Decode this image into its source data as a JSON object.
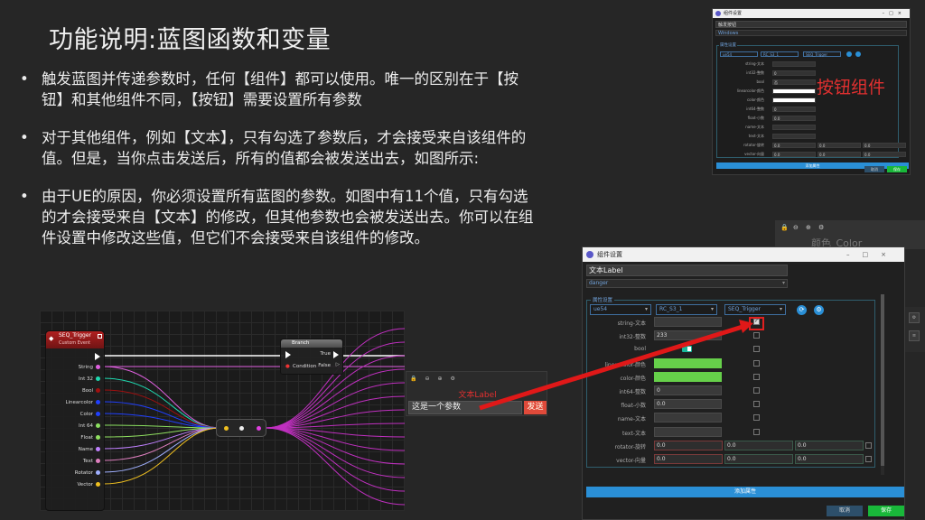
{
  "slide": {
    "title": "功能说明:蓝图函数和变量",
    "bullets": [
      "触发蓝图并传递参数时，任何【组件】都可以使用。唯一的区别在于【按钮】和其他组件不同，【按钮】需要设置所有参数",
      "对于其他组件，例如【文本】，只有勾选了参数后，才会接受来自该组件的值。但是，当你点击发送后，所有的值都会被发送出去，如图所示:",
      "由于UE的原因，你必须设置所有蓝图的参数。如图中有11个值，只有勾选的才会接受来自【文本】的修改，但其他参数也会被发送出去。你可以在组件设置中修改这些值，但它们不会接受来自该组件的修改。"
    ],
    "button_component_label": "按钮组件"
  },
  "mini_dialog": {
    "title": "组件设置",
    "name_value": "触发按钮",
    "style_value": "Windows",
    "group_label": "属性设置",
    "selects": [
      "ue54",
      "RC_S3_1",
      "SEQ_Trigger"
    ],
    "rows": [
      {
        "key": "string-文本",
        "value": ""
      },
      {
        "key": "int32-整数",
        "value": "0"
      },
      {
        "key": "bool",
        "value": "否"
      },
      {
        "key": "linearcolor-颜色",
        "value": ""
      },
      {
        "key": "color-颜色",
        "value": ""
      },
      {
        "key": "int64-整数",
        "value": "0"
      },
      {
        "key": "float-小数",
        "value": "0.0"
      },
      {
        "key": "name-文本",
        "value": ""
      },
      {
        "key": "text-文本",
        "value": ""
      },
      {
        "key": "rotator-旋转",
        "value": "0.0"
      },
      {
        "key": "vector-向量",
        "value": "0.0"
      }
    ],
    "add_label": "添加属性",
    "cancel_label": "取消",
    "save_label": "保存"
  },
  "blueprint": {
    "event_title": "SEQ_Trigger",
    "event_sub": "Custom Event",
    "pins": [
      {
        "label": "String",
        "color": "#e060e0"
      },
      {
        "label": "Int 32",
        "color": "#1ed9b0"
      },
      {
        "label": "Bool",
        "color": "#a01010"
      },
      {
        "label": "Linearcolor",
        "color": "#2040ff"
      },
      {
        "label": "Color",
        "color": "#2040ff"
      },
      {
        "label": "Int 64",
        "color": "#8be060"
      },
      {
        "label": "Float",
        "color": "#90e060"
      },
      {
        "label": "Name",
        "color": "#c080ff"
      },
      {
        "label": "Text",
        "color": "#e080c0"
      },
      {
        "label": "Rotator",
        "color": "#a0b0ff"
      },
      {
        "label": "Vector",
        "color": "#f0c020"
      }
    ],
    "branch_title": "Branch",
    "branch_condition": "Condition",
    "branch_true": "True",
    "branch_false": "False"
  },
  "bg_dialog": {
    "text": "颜色_Color"
  },
  "dialog": {
    "title": "组件设置",
    "name_value": "文本Label",
    "style_value": "danger",
    "group_label": "属性设置",
    "selects": [
      "ue54",
      "RC_S3_1",
      "SEQ_Trigger"
    ],
    "rows": [
      {
        "key": "string-文本",
        "value": "",
        "type": "text"
      },
      {
        "key": "int32-整数",
        "value": "233",
        "type": "text"
      },
      {
        "key": "bool",
        "value": "",
        "type": "toggle"
      },
      {
        "key": "linearcolor-颜色",
        "value": "",
        "type": "green"
      },
      {
        "key": "color-颜色",
        "value": "",
        "type": "green"
      },
      {
        "key": "int64-整数",
        "value": "0",
        "type": "text"
      },
      {
        "key": "float-小数",
        "value": "0.0",
        "type": "text"
      },
      {
        "key": "name-文本",
        "value": "",
        "type": "text"
      },
      {
        "key": "text-文本",
        "value": "",
        "type": "text"
      },
      {
        "key": "rotator-旋转",
        "value": "0.0",
        "type": "vec"
      },
      {
        "key": "vector-向量",
        "value": "0.0",
        "type": "vec"
      }
    ],
    "add_label": "添加属性",
    "cancel_label": "取消",
    "save_label": "保存"
  },
  "text_widget": {
    "label": "文本Label",
    "input_value": "这是一个参数",
    "send_label": "发送"
  },
  "colors": {
    "accent_blue": "#2a8fd6",
    "save_green": "#19b83a",
    "highlight_red": "#e02020"
  }
}
